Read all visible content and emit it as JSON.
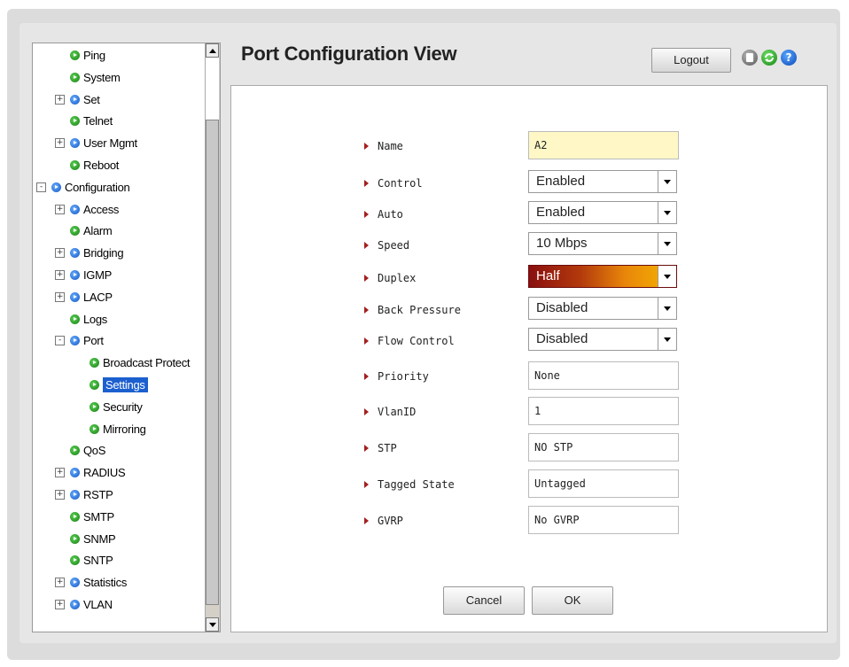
{
  "tree": {
    "items": [
      {
        "label": "Ping",
        "level": 1,
        "expander": "",
        "bullet": "green"
      },
      {
        "label": "System",
        "level": 1,
        "expander": "",
        "bullet": "green"
      },
      {
        "label": "Set",
        "level": 1,
        "expander": "+",
        "bullet": "blue"
      },
      {
        "label": "Telnet",
        "level": 1,
        "expander": "",
        "bullet": "green"
      },
      {
        "label": "User Mgmt",
        "level": 1,
        "expander": "+",
        "bullet": "blue"
      },
      {
        "label": "Reboot",
        "level": 1,
        "expander": "",
        "bullet": "green"
      },
      {
        "label": "Configuration",
        "level": 0,
        "expander": "-",
        "bullet": "blue"
      },
      {
        "label": "Access",
        "level": 1,
        "expander": "+",
        "bullet": "blue"
      },
      {
        "label": "Alarm",
        "level": 1,
        "expander": "",
        "bullet": "green"
      },
      {
        "label": "Bridging",
        "level": 1,
        "expander": "+",
        "bullet": "blue"
      },
      {
        "label": "IGMP",
        "level": 1,
        "expander": "+",
        "bullet": "blue"
      },
      {
        "label": "LACP",
        "level": 1,
        "expander": "+",
        "bullet": "blue"
      },
      {
        "label": "Logs",
        "level": 1,
        "expander": "",
        "bullet": "green"
      },
      {
        "label": "Port",
        "level": 1,
        "expander": "-",
        "bullet": "blue"
      },
      {
        "label": "Broadcast Protect",
        "level": 2,
        "expander": "",
        "bullet": "green"
      },
      {
        "label": "Settings",
        "level": 2,
        "expander": "",
        "bullet": "green",
        "selected": true
      },
      {
        "label": "Security",
        "level": 2,
        "expander": "",
        "bullet": "green"
      },
      {
        "label": "Mirroring",
        "level": 2,
        "expander": "",
        "bullet": "green"
      },
      {
        "label": "QoS",
        "level": 1,
        "expander": "",
        "bullet": "green"
      },
      {
        "label": "RADIUS",
        "level": 1,
        "expander": "+",
        "bullet": "blue"
      },
      {
        "label": "RSTP",
        "level": 1,
        "expander": "+",
        "bullet": "blue"
      },
      {
        "label": "SMTP",
        "level": 1,
        "expander": "",
        "bullet": "green"
      },
      {
        "label": "SNMP",
        "level": 1,
        "expander": "",
        "bullet": "green"
      },
      {
        "label": "SNTP",
        "level": 1,
        "expander": "",
        "bullet": "green"
      },
      {
        "label": "Statistics",
        "level": 1,
        "expander": "+",
        "bullet": "blue"
      },
      {
        "label": "VLAN",
        "level": 1,
        "expander": "+",
        "bullet": "blue"
      }
    ]
  },
  "header": {
    "title": "Port Configuration View",
    "logout_label": "Logout",
    "icons": [
      "save-icon",
      "refresh-icon",
      "help-icon"
    ],
    "help_glyph": "?"
  },
  "form": {
    "name": {
      "label": "Name",
      "value": "A2"
    },
    "control": {
      "label": "Control",
      "value": "Enabled"
    },
    "auto": {
      "label": "Auto",
      "value": "Enabled"
    },
    "speed": {
      "label": "Speed",
      "value": "10 Mbps"
    },
    "duplex": {
      "label": "Duplex",
      "value": "Half"
    },
    "back_pressure": {
      "label": "Back Pressure",
      "value": "Disabled"
    },
    "flow_control": {
      "label": "Flow Control",
      "value": "Disabled"
    },
    "priority": {
      "label": "Priority",
      "value": "None"
    },
    "vlanid": {
      "label": "VlanID",
      "value": "1"
    },
    "stp": {
      "label": "STP",
      "value": "NO STP"
    },
    "tagged_state": {
      "label": "Tagged State",
      "value": "Untagged"
    },
    "gvrp": {
      "label": "GVRP",
      "value": "No GVRP"
    }
  },
  "buttons": {
    "cancel": "Cancel",
    "ok": "OK"
  },
  "colors": {
    "accent_label_arrow": "#a32020",
    "selection": "#1c5fcf",
    "name_field_bg": "#fff8c6"
  }
}
